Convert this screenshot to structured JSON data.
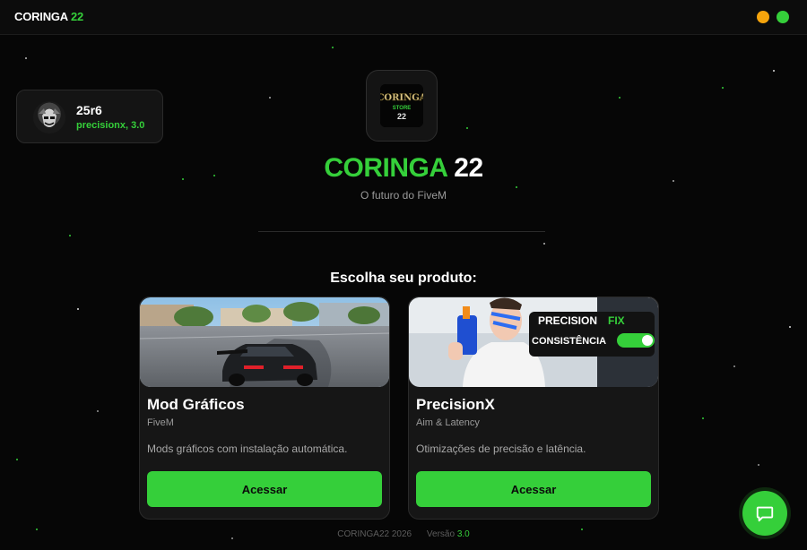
{
  "window": {
    "brand": "CORINGA",
    "brand_num": "22"
  },
  "user": {
    "name": "25r6",
    "subtitle": "precisionx, 3.0"
  },
  "hero": {
    "title_a": "CORINGA",
    "title_b": "22",
    "tagline": "O futuro do FiveM"
  },
  "logo": {
    "l1": "CORINGA",
    "l2": "STORE",
    "l3": "22"
  },
  "section_title": "Escolha seu produto:",
  "products": [
    {
      "title": "Mod Gráficos",
      "tag": "FiveM",
      "description": "Mods gráficos com instalação automática.",
      "button": "Acessar"
    },
    {
      "title": "PrecisionX",
      "tag": "Aim & Latency",
      "description": "Otimizações de precisão e latência.",
      "button": "Acessar",
      "banner_a": "PRECISION",
      "banner_b": "FIX",
      "banner_c": "CONSISTÊNCIA"
    }
  ],
  "footer": {
    "copyright": "CORINGA22 2026",
    "version_label": "Versão",
    "version": "3.0"
  },
  "colors": {
    "accent": "#35cf3a",
    "background": "#060606",
    "minimize": "#f5a40c"
  },
  "icons": [
    "chat-icon",
    "minimize-icon",
    "maximize-icon",
    "avatar"
  ]
}
